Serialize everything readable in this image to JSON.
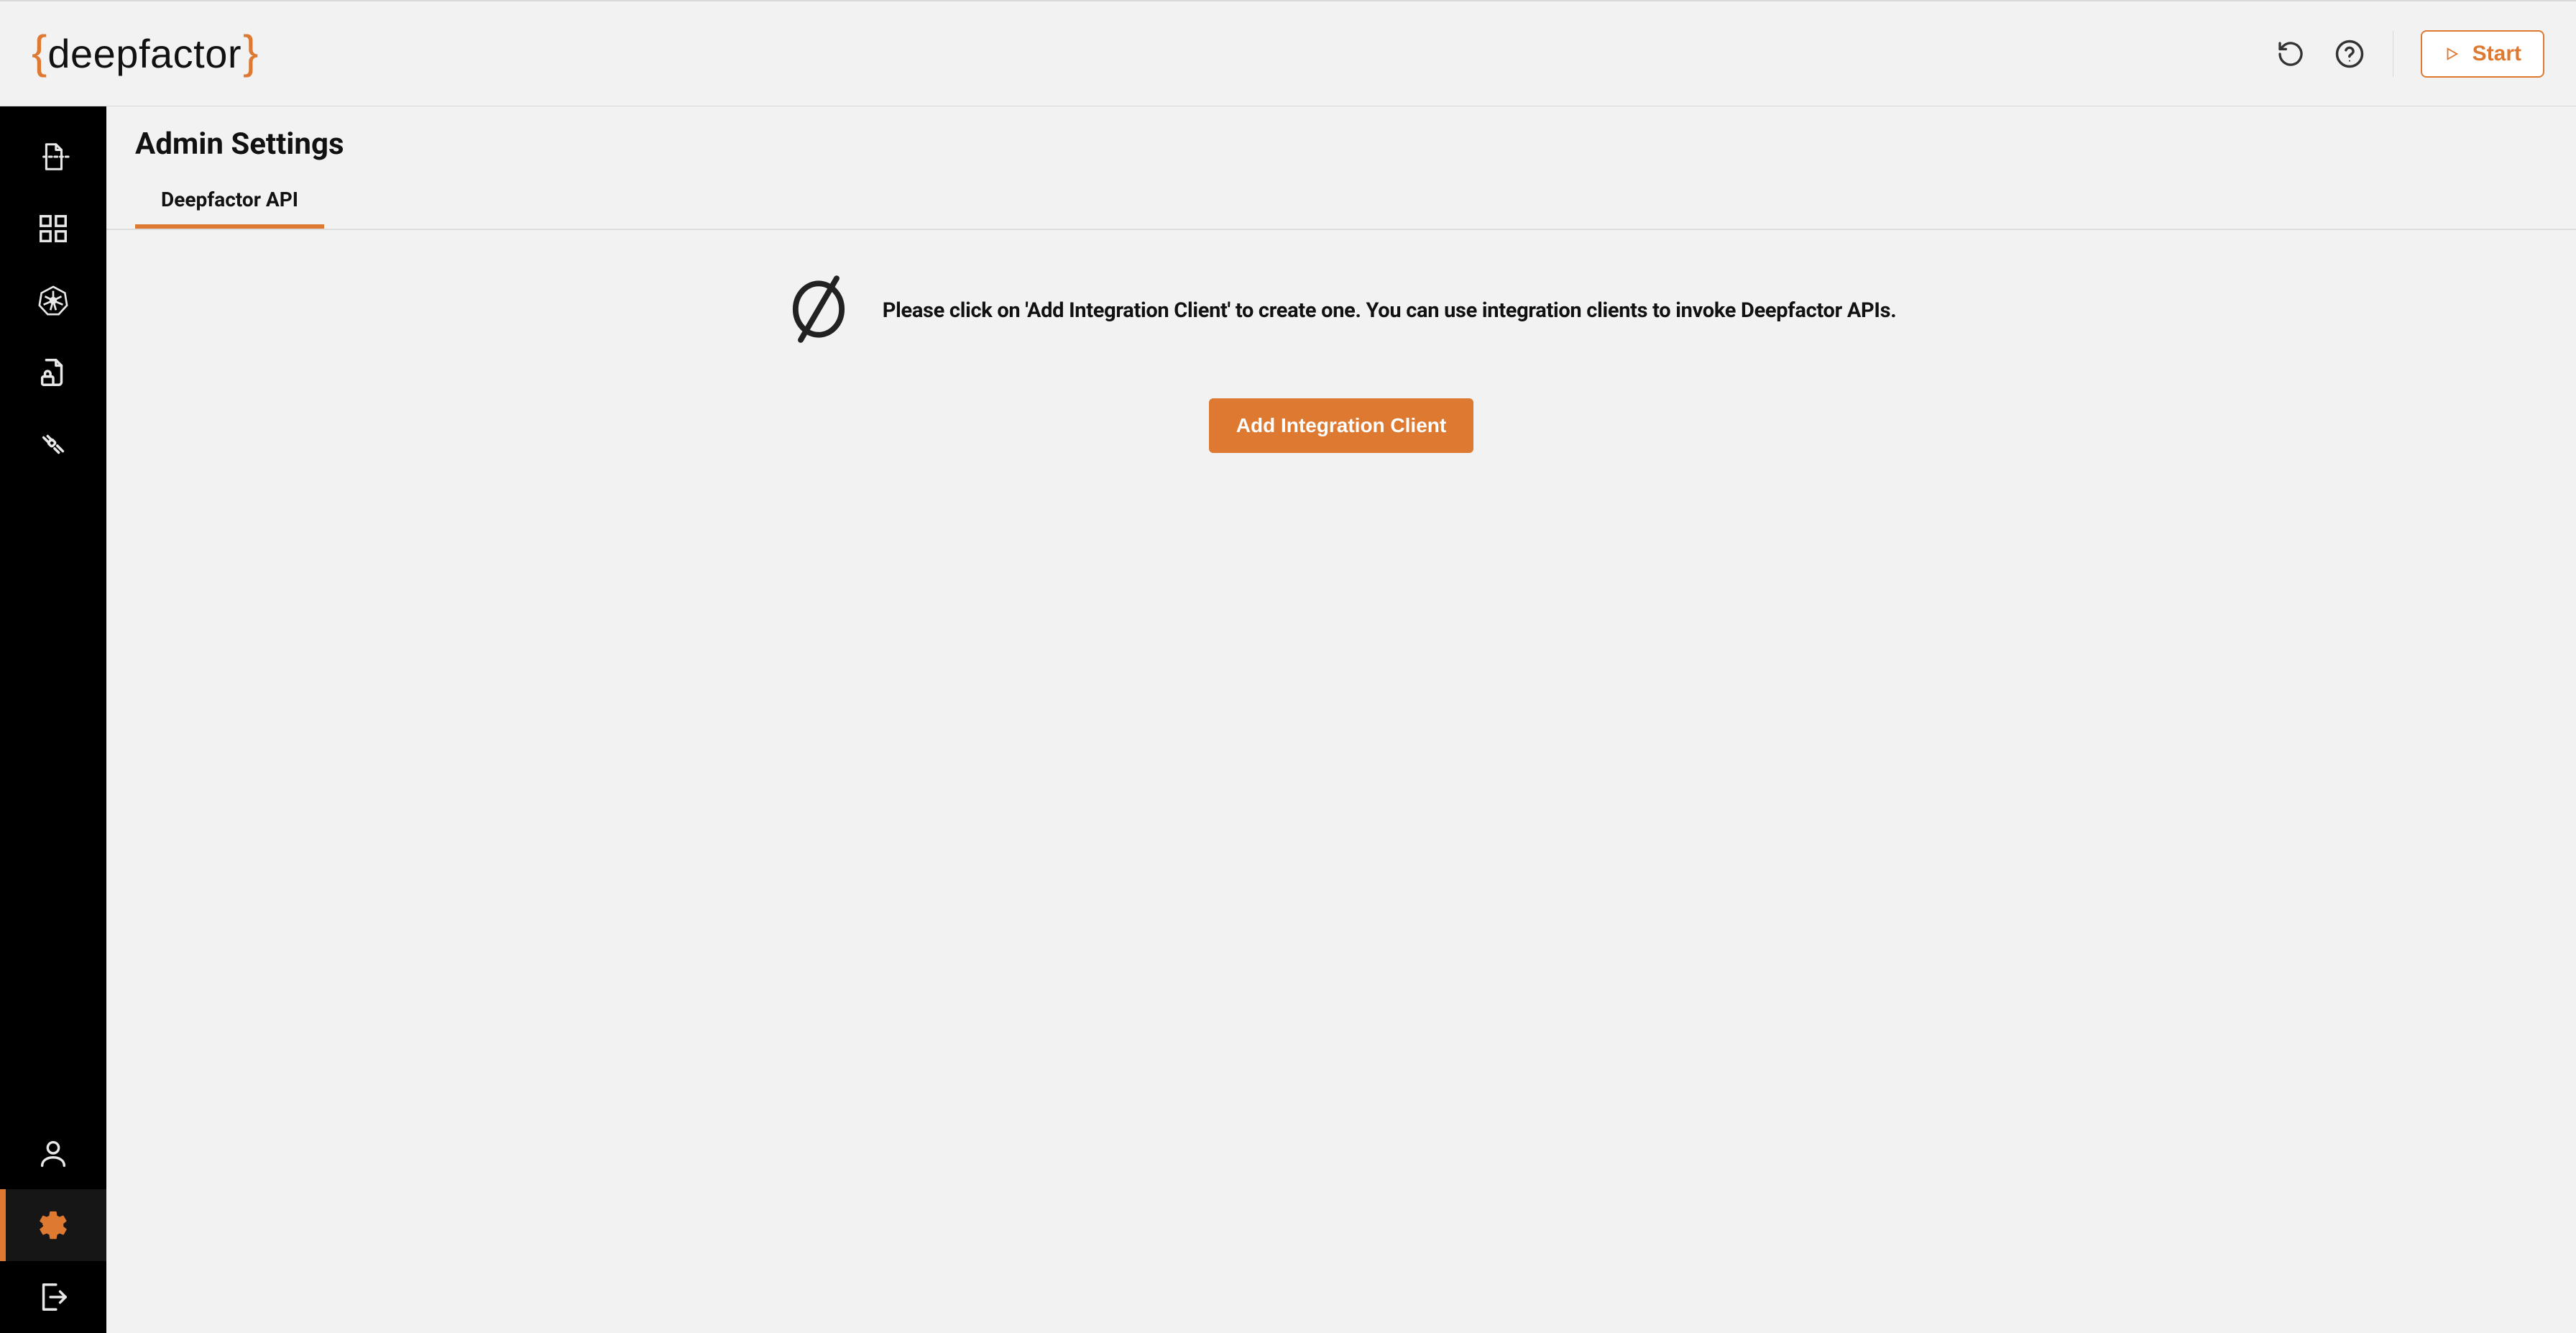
{
  "brand": {
    "open_brace": "{",
    "name": "deepfactor",
    "close_brace": "}"
  },
  "header": {
    "start_label": "Start"
  },
  "sidebar": {
    "top_items": [
      {
        "id": "insights"
      },
      {
        "id": "dashboard"
      },
      {
        "id": "kubernetes"
      },
      {
        "id": "security"
      },
      {
        "id": "integrations"
      }
    ],
    "bottom_items": [
      {
        "id": "user"
      },
      {
        "id": "settings",
        "active": true
      },
      {
        "id": "logout"
      }
    ]
  },
  "page": {
    "title": "Admin Settings",
    "tabs": [
      {
        "label": "Deepfactor API",
        "active": true
      }
    ],
    "empty_message": "Please click on 'Add Integration Client' to create one. You can use integration clients to invoke Deepfactor APIs.",
    "add_button_label": "Add Integration Client"
  }
}
